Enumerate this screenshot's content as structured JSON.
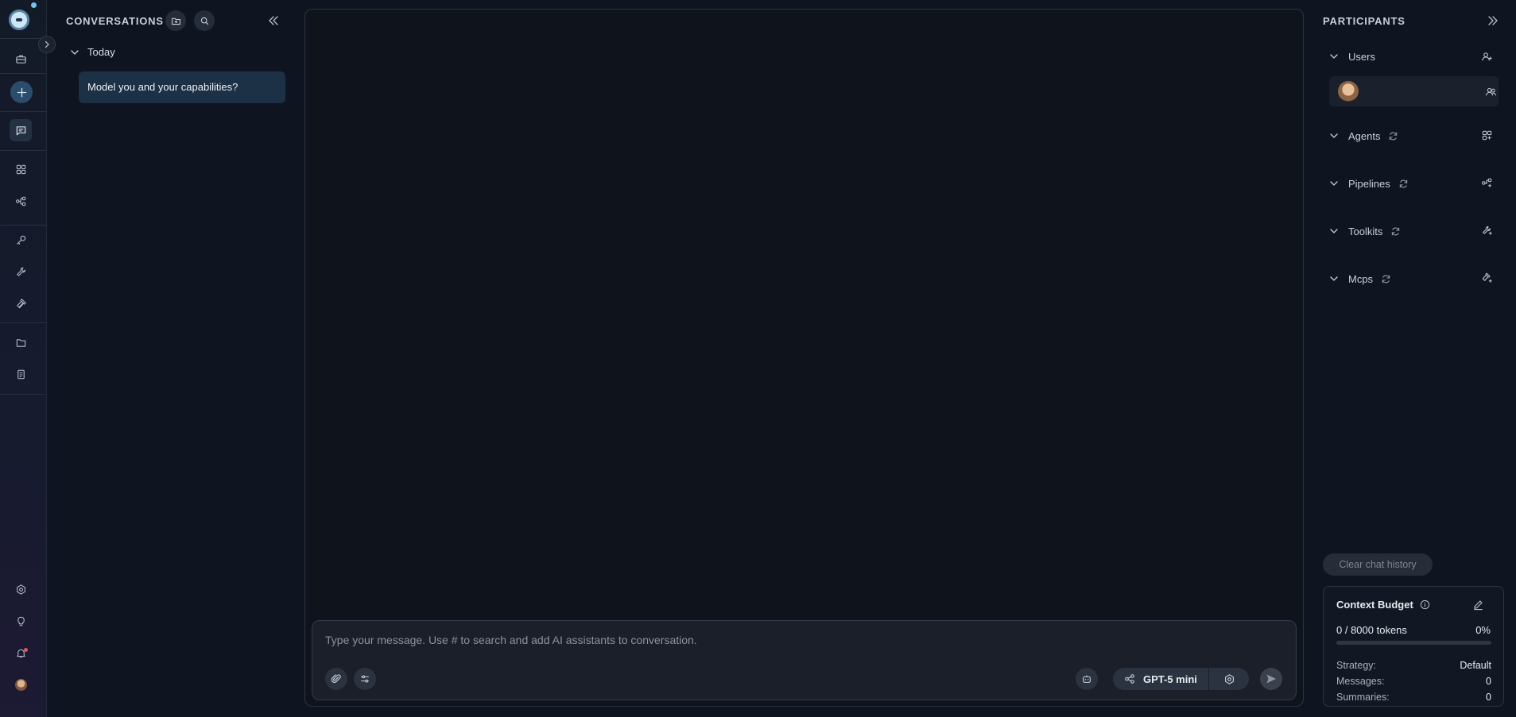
{
  "rail": {
    "items": [
      {
        "name": "briefcase-icon"
      },
      {
        "name": "plus-icon"
      },
      {
        "name": "chat-icon"
      },
      {
        "name": "grid-icon"
      },
      {
        "name": "pipeline-icon"
      },
      {
        "name": "key-icon"
      },
      {
        "name": "wrench-icon"
      },
      {
        "name": "layers-icon"
      },
      {
        "name": "folder-icon"
      },
      {
        "name": "documents-icon"
      },
      {
        "name": "settings-icon"
      },
      {
        "name": "lightbulb-icon"
      },
      {
        "name": "bell-icon"
      },
      {
        "name": "user-avatar"
      }
    ]
  },
  "conversations": {
    "header": "CONVERSATIONS",
    "groups": [
      {
        "label": "Today",
        "items": [
          {
            "title": "Model you and your capabilities?"
          }
        ]
      }
    ]
  },
  "composer": {
    "placeholder": "Type your message. Use # to search and add AI assistants to conversation.",
    "model": "GPT-5 mini"
  },
  "participants": {
    "header": "PARTICIPANTS",
    "sections": {
      "users": "Users",
      "agents": "Agents",
      "pipelines": "Pipelines",
      "toolkits": "Toolkits",
      "mcps": "Mcps"
    },
    "clear_history": "Clear chat history",
    "budget": {
      "title": "Context Budget",
      "tokens": "0 / 8000 tokens",
      "percent": "0%",
      "fill_fraction": 0,
      "strategy_label": "Strategy:",
      "strategy_value": "Default",
      "messages_label": "Messages:",
      "messages_value": "0",
      "summaries_label": "Summaries:",
      "summaries_value": "0"
    }
  },
  "colors": {
    "background": "#0f1520",
    "accent": "#5aa8e0",
    "selected_item": "#1c3046"
  }
}
